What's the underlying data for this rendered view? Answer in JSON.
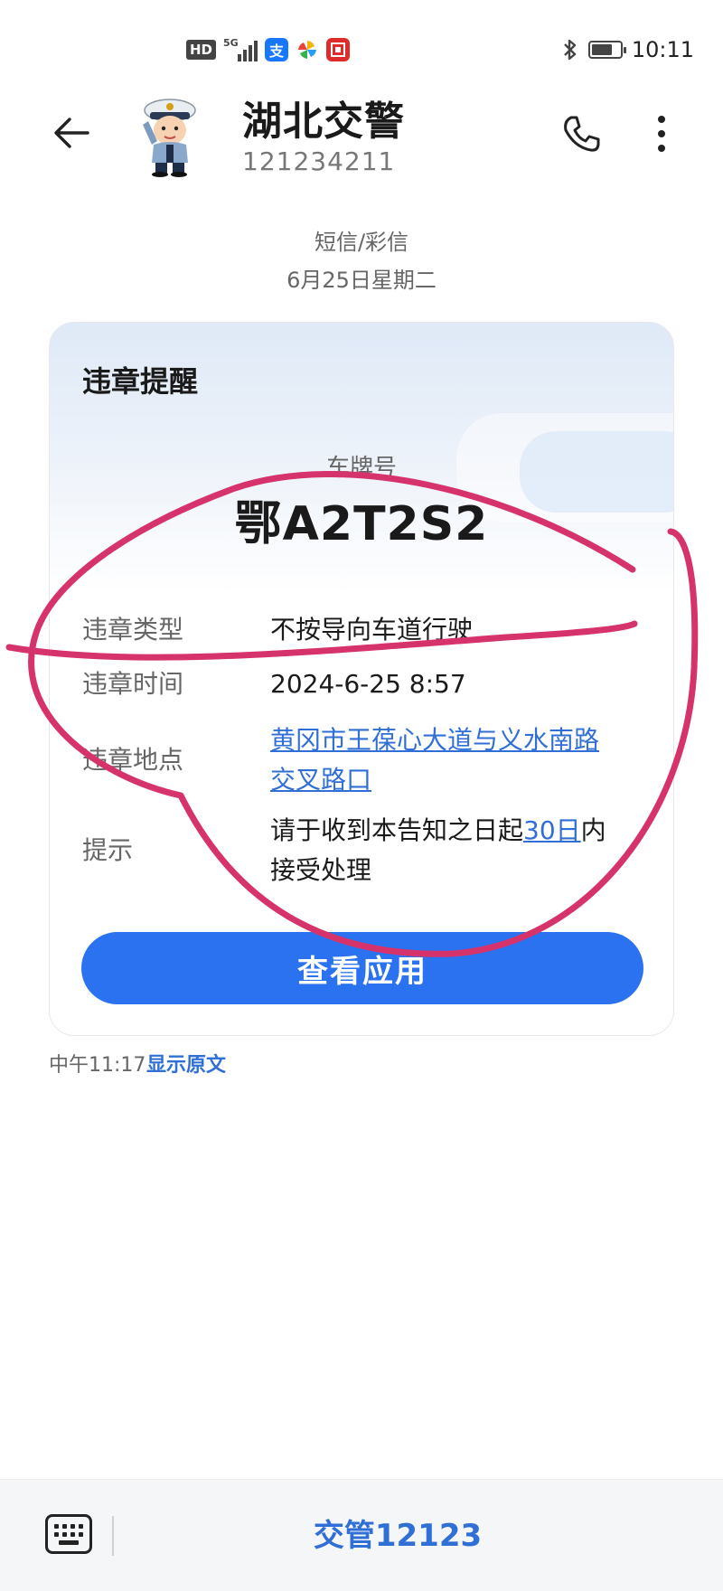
{
  "status_bar": {
    "hd": "HD",
    "network": "5G",
    "time": "10:11",
    "app_icons": [
      "alipay-icon",
      "pinwheel-icon",
      "app-badge-icon"
    ]
  },
  "header": {
    "name": "湖北交警",
    "number": "121234211",
    "icons": [
      "back-arrow-icon",
      "police-avatar",
      "phone-icon",
      "more-vertical-icon"
    ]
  },
  "thread": {
    "type": "短信/彩信",
    "date": "6月25日星期二"
  },
  "card": {
    "title": "违章提醒",
    "plate_label": "车牌号",
    "plate_value": "鄂A2T2S2",
    "rows": [
      {
        "label": "违章类型",
        "value": "不按导向车道行驶"
      },
      {
        "label": "违章时间",
        "value": "2024-6-25 8:57"
      },
      {
        "label": "违章地点",
        "value_line1": "黄冈市王葆心大道与义水南路",
        "value_line2": "交叉路口"
      },
      {
        "label": "提示",
        "value_pre": "请于收到本告知之日起",
        "value_link": "30日",
        "value_post": "内",
        "value_line2": "接受处理"
      }
    ],
    "button_label": "查看应用"
  },
  "message_meta": {
    "time": "中午11:17",
    "show_original": "显示原文"
  },
  "bottom_bar": {
    "menu_label": "交管12123",
    "icons": [
      "keyboard-icon"
    ]
  },
  "colors": {
    "accent_blue": "#2a72f0",
    "link_blue": "#2f6fd6",
    "annotation_pink": "#d6336c"
  }
}
